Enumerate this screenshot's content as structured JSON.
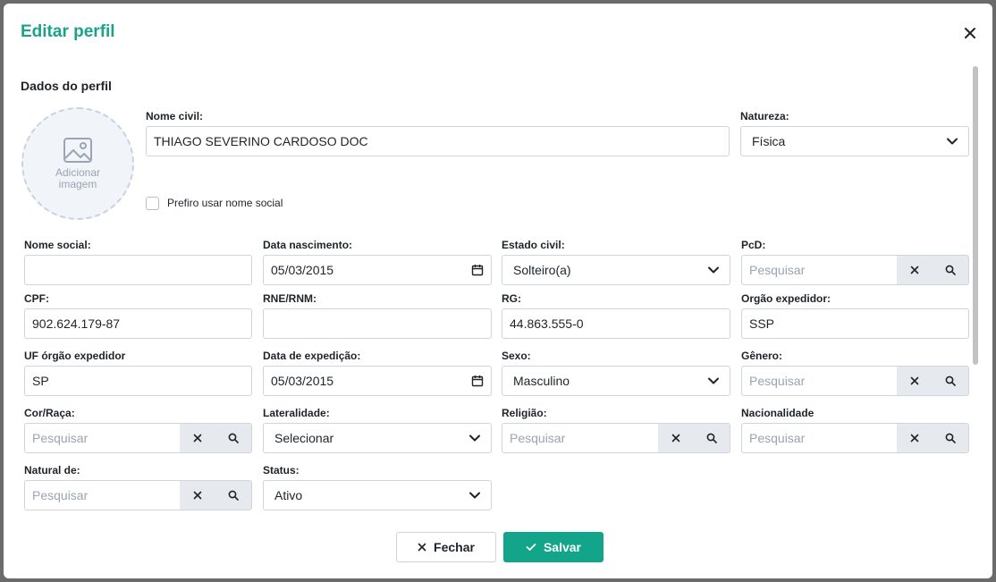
{
  "modal": {
    "title": "Editar perfil",
    "section_title": "Dados do perfil"
  },
  "avatar": {
    "label": "Adicionar imagem"
  },
  "nome_civil": {
    "label": "Nome civil:",
    "value": "THIAGO SEVERINO CARDOSO DOC"
  },
  "natureza": {
    "label": "Natureza:",
    "value": "Física"
  },
  "social_check": {
    "label": "Prefiro usar nome social",
    "checked": false
  },
  "nome_social": {
    "label": "Nome social:",
    "value": ""
  },
  "data_nascimento": {
    "label": "Data nascimento:",
    "value": "05/03/2015"
  },
  "estado_civil": {
    "label": "Estado civil:",
    "value": "Solteiro(a)"
  },
  "pcd": {
    "label": "PcD:",
    "placeholder": "Pesquisar"
  },
  "cpf": {
    "label": "CPF:",
    "value": "902.624.179-87"
  },
  "rne": {
    "label": "RNE/RNM:",
    "value": ""
  },
  "rg": {
    "label": "RG:",
    "value": "44.863.555-0"
  },
  "orgao_expedidor": {
    "label": "Orgão expedidor:",
    "value": "SSP"
  },
  "uf_orgao": {
    "label": "UF órgão expedidor",
    "value": "SP"
  },
  "data_expedicao": {
    "label": "Data de expedição:",
    "value": "05/03/2015"
  },
  "sexo": {
    "label": "Sexo:",
    "value": "Masculino"
  },
  "genero": {
    "label": "Gênero:",
    "placeholder": "Pesquisar"
  },
  "cor_raca": {
    "label": "Cor/Raça:",
    "placeholder": "Pesquisar"
  },
  "lateralidade": {
    "label": "Lateralidade:",
    "value": "Selecionar"
  },
  "religiao": {
    "label": "Religião:",
    "placeholder": "Pesquisar"
  },
  "nacionalidade": {
    "label": "Nacionalidade",
    "placeholder": "Pesquisar"
  },
  "natural_de": {
    "label": "Natural de:",
    "placeholder": "Pesquisar"
  },
  "status": {
    "label": "Status:",
    "value": "Ativo"
  },
  "footer": {
    "close_label": "Fechar",
    "save_label": "Salvar"
  },
  "colors": {
    "accent": "#13a58a",
    "title": "#1aa389",
    "lookup_button": "#e6e9ed"
  }
}
